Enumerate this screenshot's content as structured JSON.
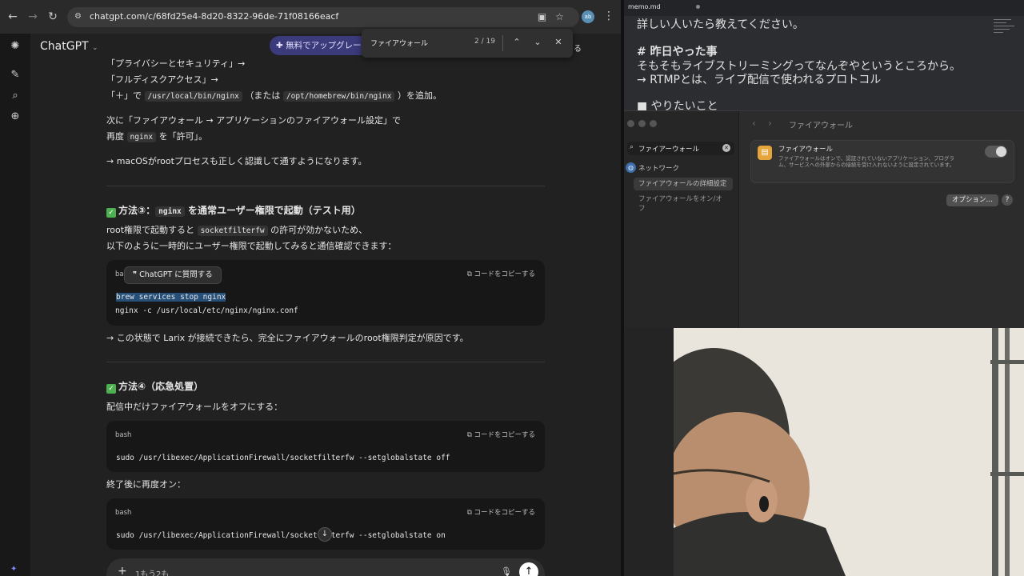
{
  "browser": {
    "url": "chatgpt.com/c/68fd25e4-8d20-8322-96de-71f08166eacf",
    "profile_initials": "ab",
    "model_picker": "ChatGPT",
    "upgrade_label": "無料でアップグレード",
    "share_stub": "る",
    "find": {
      "query": "ファイアウォール",
      "count": "2 / 19"
    }
  },
  "chat": {
    "lines": {
      "l1": "「プライバシーとセキュリティ」→",
      "l2": "「フルディスクアクセス」→",
      "l3_prefix": "「＋」で",
      "l3_code1": "/usr/local/bin/nginx",
      "l3_mid": "（または",
      "l3_code2": "/opt/homebrew/bin/nginx",
      "l3_suffix": "）を追加。",
      "l4": "次に「ファイアウォール → アプリケーションのファイアウォール設定」で",
      "l5_prefix": "再度",
      "l5_code": "nginx",
      "l5_suffix": "を「許可」。",
      "l6": "→ macOSがrootプロセスも正しく認識して通すようになります。",
      "h3_prefix": "方法③：",
      "h3_code": "nginx",
      "h3_suffix": "を通常ユーザー権限で起動（テスト用）",
      "p1_prefix": "root権限で起動すると",
      "p1_code": "socketfilterfw",
      "p1_suffix": "の許可が効かないため、",
      "p2": "以下のように一時的にユーザー権限で起動してみると通信確認できます：",
      "after_code": "→ この状態で Larix が接続できたら、完全にファイアウォールのroot権限判定が原因です。",
      "h4": "方法④（応急処置）",
      "p3": "配信中だけファイアウォールをオフにする：",
      "p4": "終了後に再度オン："
    },
    "code_blocks": [
      {
        "lang": "bash",
        "copy": "コードをコピーする",
        "tooltip": "ChatGPT に質問する",
        "lines": [
          "brew services stop nginx",
          "nginx -c /usr/local/etc/nginx/nginx.conf"
        ]
      },
      {
        "lang": "bash",
        "copy": "コードをコピーする",
        "lines": [
          "sudo /usr/libexec/ApplicationFirewall/socketfilterfw --setglobalstate off"
        ]
      },
      {
        "lang": "bash",
        "copy": "コードをコピーする",
        "lines": [
          "sudo /usr/libexec/ApplicationFirewall/socketfilterfw --setglobalstate on"
        ]
      }
    ],
    "composer_text": "1もう2も"
  },
  "memo": {
    "tab": "memo.md",
    "lines": [
      "詳しい人いたら教えてください。",
      "# 昨日やった事",
      "そもそもライブストリーミングってなんぞやというところから。",
      "→ RTMPとは、ライブ配信で使われるプロトコル",
      "■ やりたいこと"
    ]
  },
  "settings": {
    "search": "ファイアーウォール",
    "sidebar_network": "ネットワーク",
    "sidebar_item1": "ファイアウォールの詳細設定",
    "sidebar_item2": "ファイアウォールをオン/オフ",
    "title": "ファイアウォール",
    "card_title": "ファイアウォール",
    "card_desc": "ファイアウォールはオンで、認証されていないアプリケーション、プログラム、サービスへの外部からの接続を受け入れないように設定されています。",
    "toggle_on": true,
    "options_label": "オプション…",
    "help_label": "?"
  },
  "colors": {
    "accent": "#3b3a7a",
    "selection": "#264f78",
    "check": "#4caf50",
    "firewall_icon": "#e5a53b"
  }
}
